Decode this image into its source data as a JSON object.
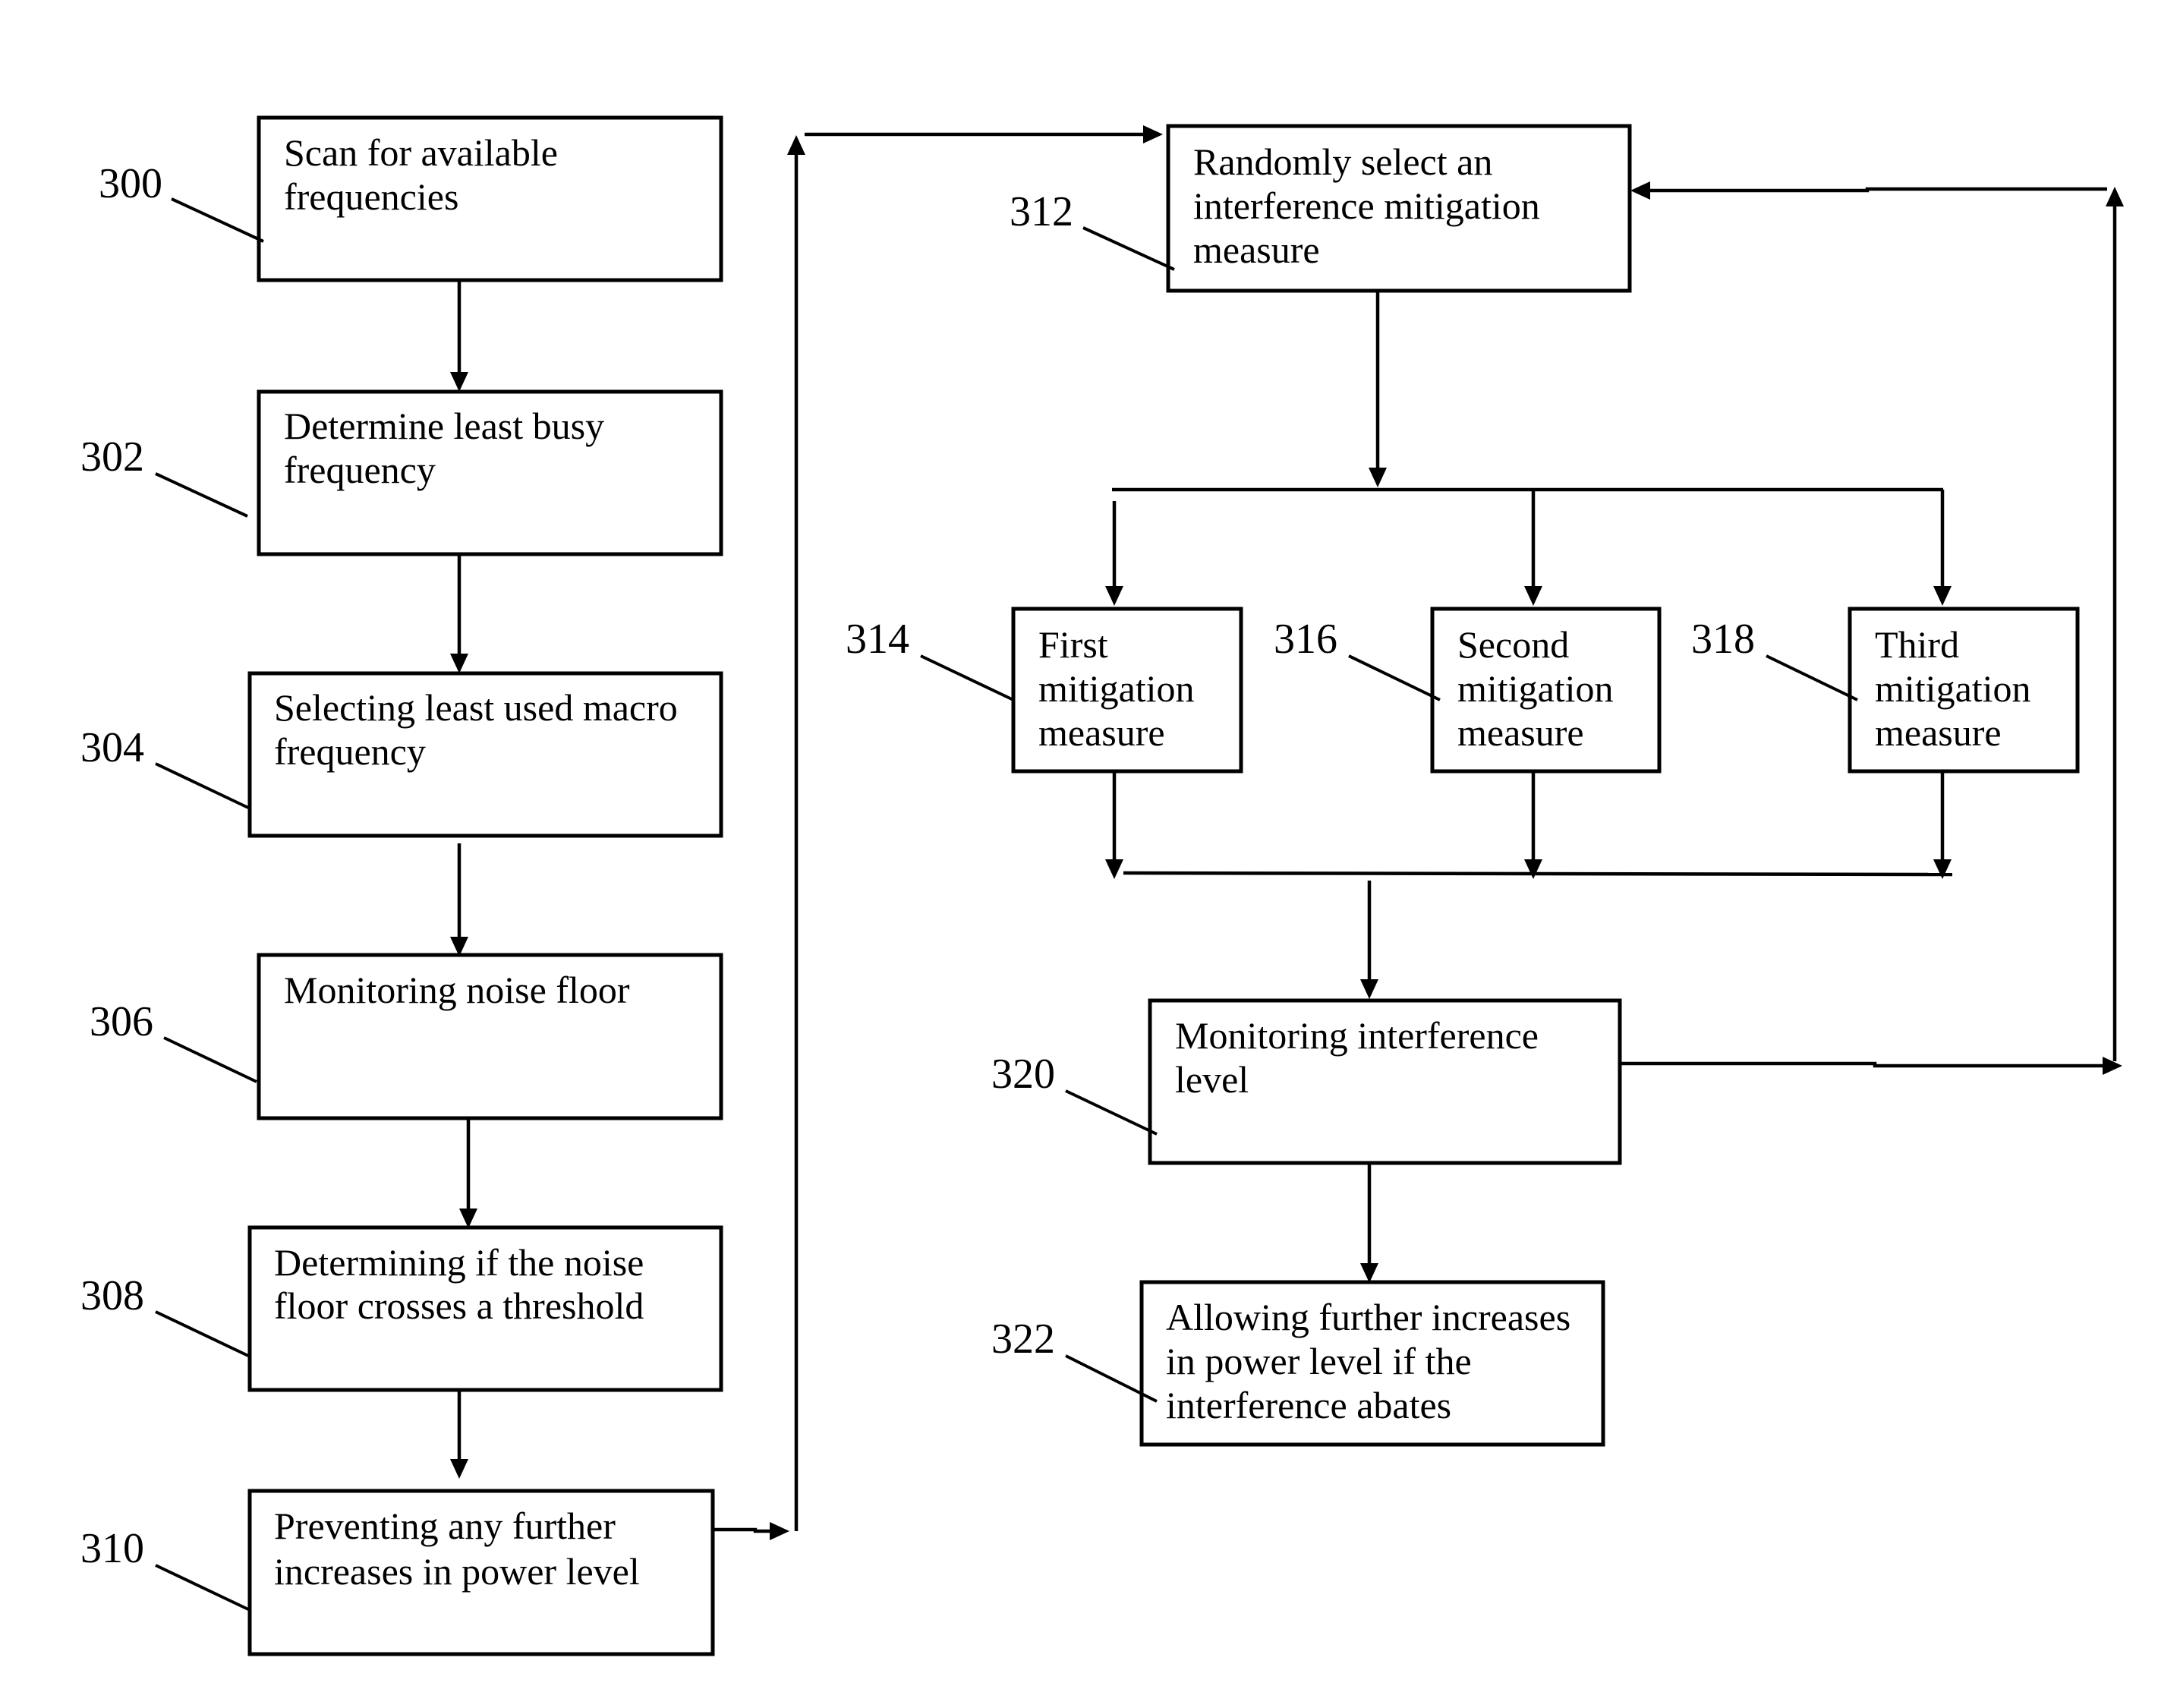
{
  "diagram": {
    "steps": [
      {
        "ref": "300",
        "lines": [
          "Scan for available",
          "frequencies"
        ]
      },
      {
        "ref": "302",
        "lines": [
          "Determine least busy",
          "frequency"
        ]
      },
      {
        "ref": "304",
        "lines": [
          "Selecting least used macro",
          "frequency"
        ]
      },
      {
        "ref": "306",
        "lines": [
          "Monitoring noise floor"
        ]
      },
      {
        "ref": "308",
        "lines": [
          "Determining if the noise",
          "floor crosses a threshold"
        ]
      },
      {
        "ref": "310",
        "lines": [
          "Preventing any further",
          "increases in power level"
        ]
      },
      {
        "ref": "312",
        "lines": [
          "Randomly select an",
          "interference mitigation",
          "measure"
        ]
      },
      {
        "ref": "314",
        "lines": [
          "First",
          "mitigation",
          "measure"
        ]
      },
      {
        "ref": "316",
        "lines": [
          "Second",
          "mitigation",
          "measure"
        ]
      },
      {
        "ref": "318",
        "lines": [
          "Third",
          "mitigation",
          "measure"
        ]
      },
      {
        "ref": "320",
        "lines": [
          "Monitoring interference",
          "level"
        ]
      },
      {
        "ref": "322",
        "lines": [
          "Allowing further increases",
          "in power level if the",
          "interference abates"
        ]
      }
    ],
    "colors": {
      "stroke": "#000000",
      "background": "#ffffff"
    }
  }
}
